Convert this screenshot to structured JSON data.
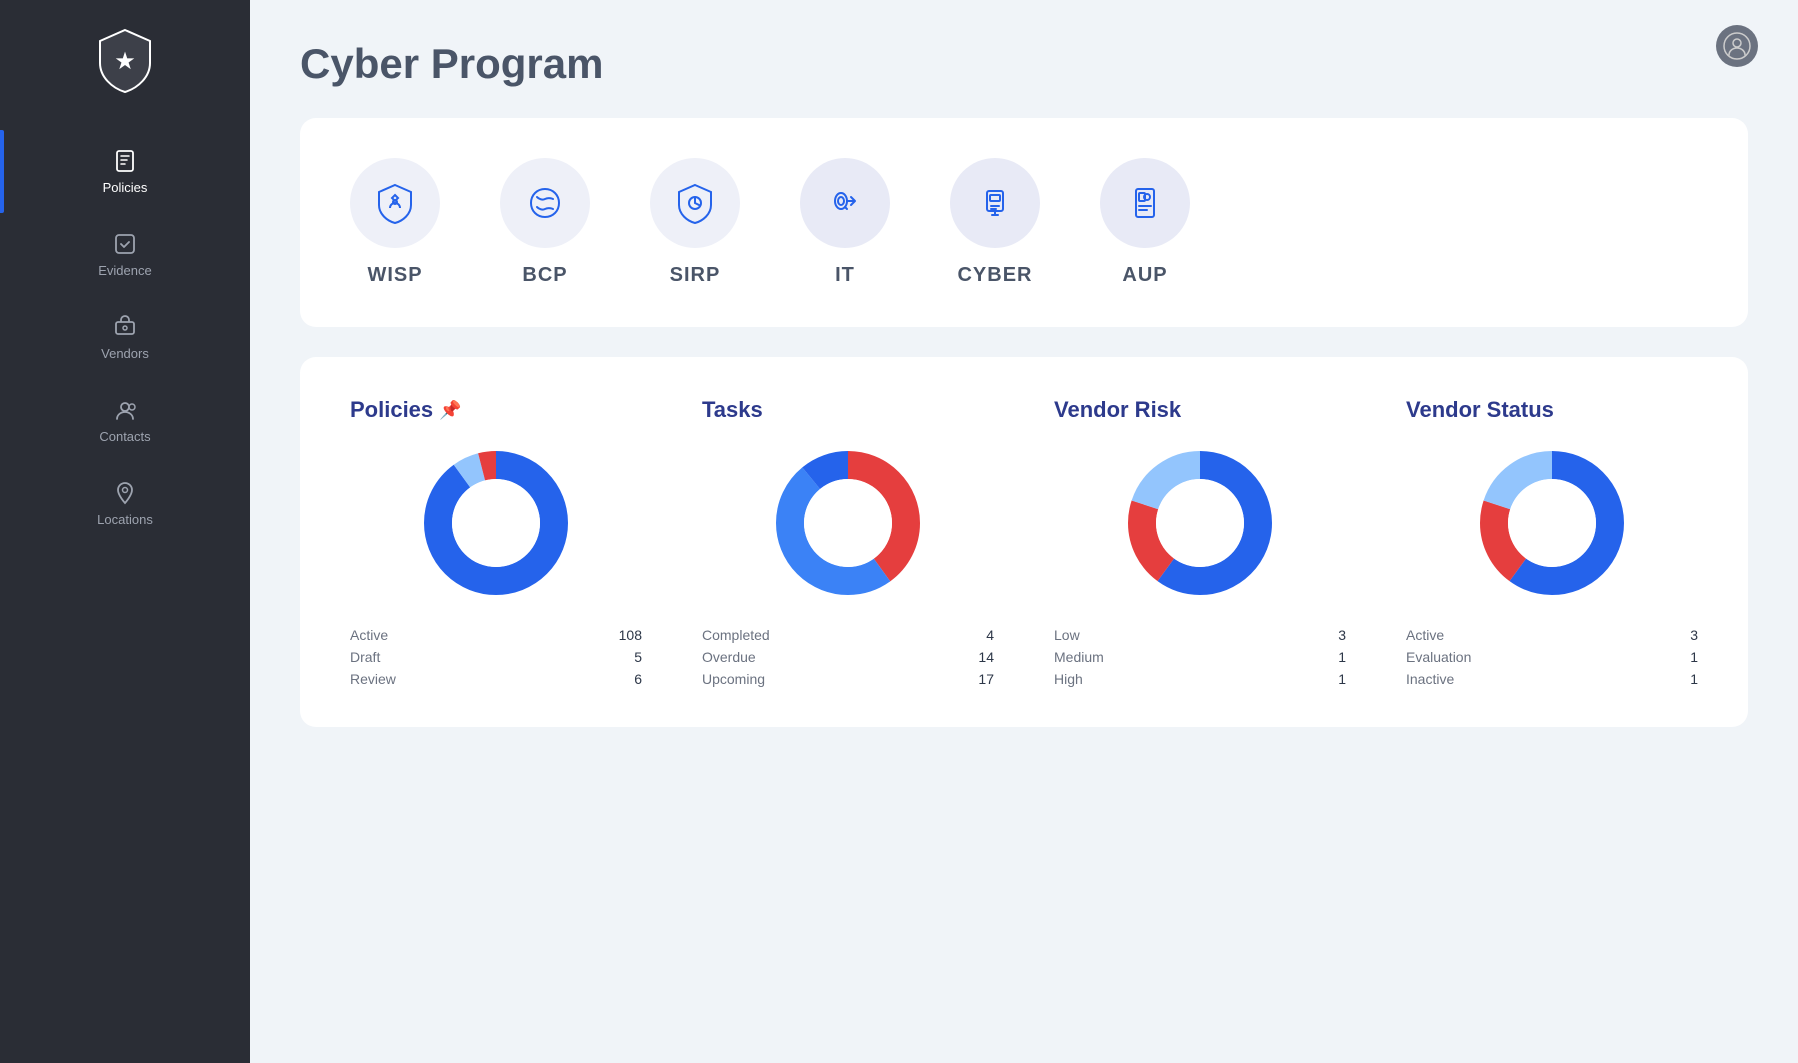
{
  "app": {
    "title": "Cyber Program"
  },
  "sidebar": {
    "items": [
      {
        "id": "policies",
        "label": "Policies",
        "active": true
      },
      {
        "id": "evidence",
        "label": "Evidence",
        "active": false
      },
      {
        "id": "vendors",
        "label": "Vendors",
        "active": false
      },
      {
        "id": "contacts",
        "label": "Contacts",
        "active": false
      },
      {
        "id": "locations",
        "label": "Locations",
        "active": false
      }
    ]
  },
  "programs": [
    {
      "id": "wisp",
      "label": "WISP"
    },
    {
      "id": "bcp",
      "label": "BCP"
    },
    {
      "id": "sirp",
      "label": "SIRP"
    },
    {
      "id": "it",
      "label": "IT"
    },
    {
      "id": "cyber",
      "label": "CYBER"
    },
    {
      "id": "aup",
      "label": "AUP"
    }
  ],
  "charts": {
    "policies": {
      "title": "Policies",
      "has_pin": true,
      "legend": [
        {
          "label": "Active",
          "value": "108"
        },
        {
          "label": "Draft",
          "value": "5"
        },
        {
          "label": "Review",
          "value": "6"
        }
      ],
      "segments": [
        {
          "color": "#2563eb",
          "percent": 90
        },
        {
          "color": "#e53e3e",
          "percent": 4
        },
        {
          "color": "#93c5fd",
          "percent": 6
        }
      ]
    },
    "tasks": {
      "title": "Tasks",
      "has_pin": false,
      "legend": [
        {
          "label": "Completed",
          "value": "4"
        },
        {
          "label": "Overdue",
          "value": "14"
        },
        {
          "label": "Upcoming",
          "value": "17"
        }
      ],
      "segments": [
        {
          "color": "#2563eb",
          "percent": 11
        },
        {
          "color": "#e53e3e",
          "percent": 40
        },
        {
          "color": "#3b82f6",
          "percent": 49
        }
      ]
    },
    "vendor_risk": {
      "title": "Vendor Risk",
      "has_pin": false,
      "legend": [
        {
          "label": "Low",
          "value": "3"
        },
        {
          "label": "Medium",
          "value": "1"
        },
        {
          "label": "High",
          "value": "1"
        }
      ],
      "segments": [
        {
          "color": "#2563eb",
          "percent": 60
        },
        {
          "color": "#e53e3e",
          "percent": 20
        },
        {
          "color": "#93c5fd",
          "percent": 20
        }
      ]
    },
    "vendor_status": {
      "title": "Vendor Status",
      "has_pin": false,
      "legend": [
        {
          "label": "Active",
          "value": "3"
        },
        {
          "label": "Evaluation",
          "value": "1"
        },
        {
          "label": "Inactive",
          "value": "1"
        }
      ],
      "segments": [
        {
          "color": "#2563eb",
          "percent": 60
        },
        {
          "color": "#e53e3e",
          "percent": 20
        },
        {
          "color": "#93c5fd",
          "percent": 20
        }
      ]
    }
  }
}
